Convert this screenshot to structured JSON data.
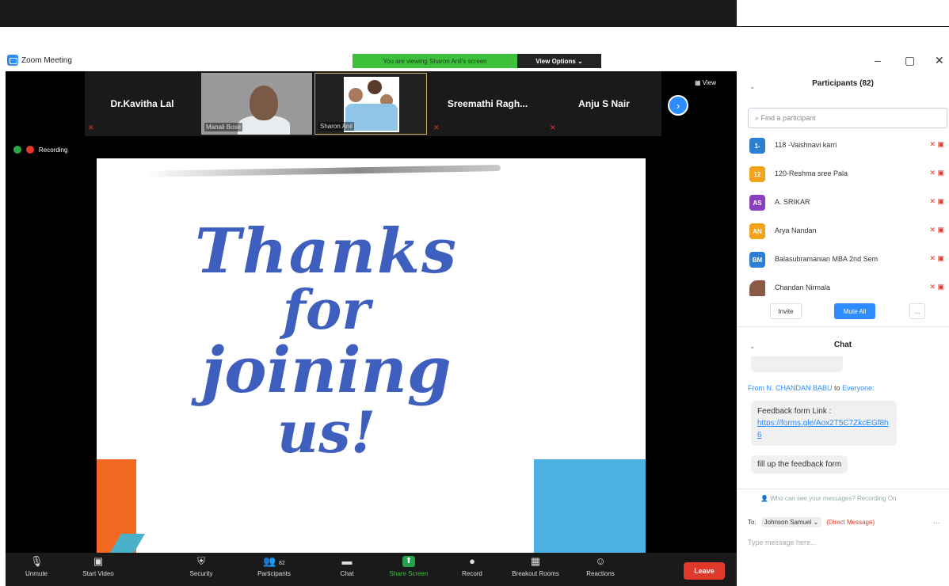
{
  "window": {
    "app_title": "Zoom Meeting",
    "sharing_banner": "You are viewing Sharon Anil's screen",
    "view_options": "View Options ⌄",
    "controls": [
      "–",
      "▢",
      "✕"
    ]
  },
  "strip": {
    "tiles": [
      {
        "name": "Dr.Kavitha Lal",
        "type": "name"
      },
      {
        "name": "Manali Bose",
        "type": "photo"
      },
      {
        "name": "Sharon Anil",
        "type": "photo"
      },
      {
        "name": "Sreemathi  Ragh...",
        "type": "name"
      },
      {
        "name": "Anju S Nair",
        "type": "name"
      }
    ],
    "view_label": "View",
    "recording_label": "Recording"
  },
  "slide": {
    "lines": [
      "Thanks",
      "for",
      "joining",
      "us!"
    ]
  },
  "toolbar": {
    "items": [
      {
        "label": "Unmute",
        "icon": "mic-muted-icon"
      },
      {
        "label": "Start Video",
        "icon": "video-off-icon"
      },
      {
        "label": "Security",
        "icon": "shield-icon"
      },
      {
        "label": "Participants",
        "icon": "people-icon",
        "count": "82"
      },
      {
        "label": "Chat",
        "icon": "chat-icon"
      },
      {
        "label": "Share Screen",
        "icon": "share-icon"
      },
      {
        "label": "Record",
        "icon": "record-icon"
      },
      {
        "label": "Breakout Rooms",
        "icon": "grid-icon"
      },
      {
        "label": "Reactions",
        "icon": "emoji-icon"
      }
    ],
    "leave": "Leave"
  },
  "participants": {
    "title": "Participants (82)",
    "search_placeholder": "Find a participant",
    "list": [
      {
        "initials": "1-",
        "name": "118 -Vaishnavi karri",
        "color": "#2d7fd1"
      },
      {
        "initials": "12",
        "name": "120-Reshma sree Pala",
        "color": "#f2a21c"
      },
      {
        "initials": "AS",
        "name": "A. SRIKAR",
        "color": "#8a3fbf"
      },
      {
        "initials": "AN",
        "name": "Arya Nandan",
        "color": "#f2a21c"
      },
      {
        "initials": "BM",
        "name": "Balasubramanian MBA 2nd Sem",
        "color": "#2d7fd1"
      },
      {
        "initials": "",
        "name": "Chandan Nirmala",
        "color": "#8a5a46"
      }
    ],
    "invite": "Invite",
    "mute_all": "Mute All",
    "more": "..."
  },
  "chat": {
    "title": "Chat",
    "sender_prefix": "From",
    "sender": "N. CHANDAN BABU",
    "sender_to": "to",
    "sender_target": "Everyone:",
    "msg1_text": "Feedback form Link :",
    "msg1_link": "https://forms.gle/Aox2T5C7ZkcEGf8h6",
    "msg2_text": "fill up the feedback form",
    "who_can_see": "Who can see your messages? Recording On",
    "to_label": "To:",
    "to_value": "Johnson Samuel ⌄",
    "direct_message": "(Direct Message)",
    "placeholder": "Type message here..."
  },
  "colors": {
    "accent": "#2d8cff",
    "danger": "#e0392b",
    "share_green": "#3dc13c",
    "slide_text": "#3f5fbf"
  }
}
